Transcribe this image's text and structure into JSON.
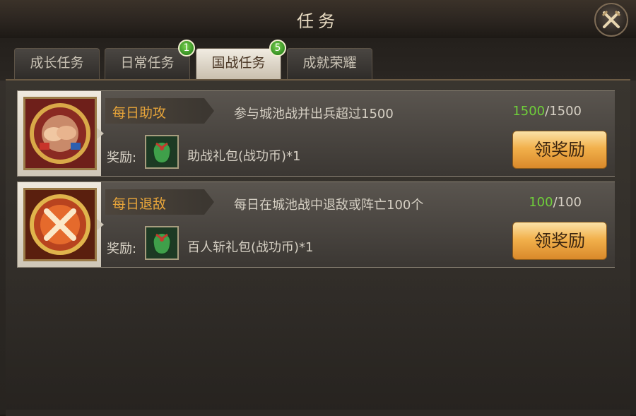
{
  "window": {
    "title": "任务",
    "close_icon": "crossed-swords-close-icon"
  },
  "tabs": [
    {
      "label": "成长任务",
      "badge": null,
      "active": false
    },
    {
      "label": "日常任务",
      "badge": "1",
      "active": false
    },
    {
      "label": "国战任务",
      "badge": "5",
      "active": true
    },
    {
      "label": "成就荣耀",
      "badge": null,
      "active": false
    }
  ],
  "tasks": [
    {
      "icon": "handshake-medal-icon",
      "name": "每日助攻",
      "description": "参与城池战并出兵超过1500",
      "progress_current": "1500",
      "progress_total": "/1500",
      "reward_label": "奖励:",
      "reward_icon": "green-gift-bag-icon",
      "reward_name": "助战礼包(战功币)*1",
      "button_label": "领奖励"
    },
    {
      "icon": "crossed-swords-medal-icon",
      "name": "每日退敌",
      "description": "每日在城池战中退敌或阵亡100个",
      "progress_current": "100",
      "progress_total": "/100",
      "reward_label": "奖励:",
      "reward_icon": "green-gift-bag-icon",
      "reward_name": "百人斩礼包(战功币)*1",
      "button_label": "领奖励"
    }
  ],
  "colors": {
    "progress_complete": "#6fcf3a",
    "task_name": "#e8a53a",
    "badge": "#3f9a27",
    "button": "#f2b14c"
  }
}
